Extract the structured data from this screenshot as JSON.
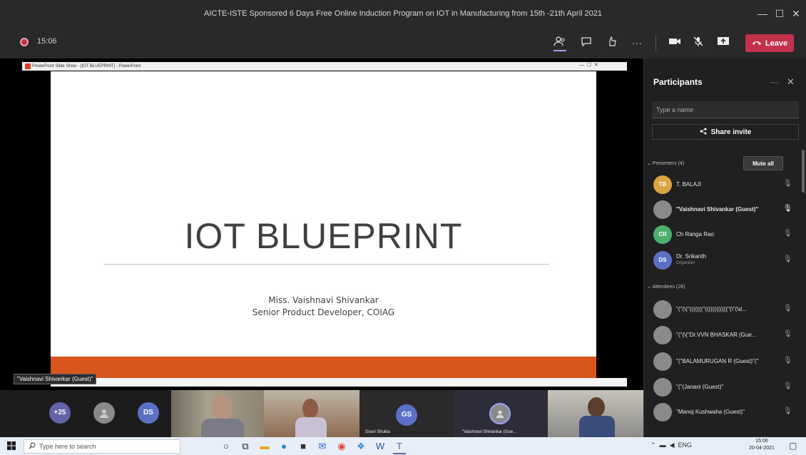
{
  "window": {
    "title": "AICTE-ISTE Sponsored 6 Days Free Online Induction Program on IOT in Manufacturing from 15th -21th April 2021",
    "minimize": "—",
    "maximize": "☐",
    "close": "✕"
  },
  "toolbar": {
    "timer": "15:06",
    "leave_label": "Leave",
    "icons": [
      "participants-icon",
      "chat-icon",
      "reactions-icon",
      "more-icon",
      "camera-icon",
      "mic-icon",
      "share-icon",
      "phone-icon"
    ]
  },
  "ppt": {
    "window_title": "PowerPoint Slide Show - [IOT BLUEPRINT] - PowerPoint",
    "slide_title": "IOT BLUEPRINT",
    "presenter_name": "Miss. Vaishnavi Shivankar",
    "presenter_role": "Senior Product Developer, COIAG"
  },
  "stage": {
    "presenter_tag": "\"Vaishnavi Shivankar (Guest)\""
  },
  "gallery": {
    "overflow_count": "+25",
    "initials_ds": "DS",
    "initials_gs": "GS",
    "gs_name": "Gouri Shukla",
    "vs_name": "\"Vaishnavi Shivankar (Gue..."
  },
  "panel": {
    "title": "Participants",
    "more": "···",
    "close": "✕",
    "search_placeholder": "Type a name",
    "share_invite": "Share invite",
    "presenters_header": "Presenters (4)",
    "mute_all": "Mute all",
    "attendees_header": "Attendees (28)",
    "presenters": [
      {
        "initials": "TB",
        "name": "T. BALAJI",
        "sub": "",
        "color": "#d9a441"
      },
      {
        "initials": "",
        "name": "\"Vaishnavi Shivankar (Guest)\"",
        "sub": "",
        "color": "#8a8a8a"
      },
      {
        "initials": "CR",
        "name": "Ch Ranga Rao",
        "sub": "",
        "color": "#4caf6d"
      },
      {
        "initials": "DS",
        "name": "Dr. Srikanth",
        "sub": "Organizer",
        "color": "#5b6fc7"
      }
    ],
    "attendees": [
      {
        "name": "\"(\"(\\(\"(((((((\"((((((((((((\"(\\\"(\\d...",
        "color": "#8a8a8a"
      },
      {
        "name": "\"(\"(\\(\"Dr.VVN BHASKAR (Gue...",
        "color": "#8a8a8a"
      },
      {
        "name": "\"(\"BALAMURUGAN R (Guest)\"(\"",
        "color": "#8a8a8a"
      },
      {
        "name": "\"(\"(Janani (Guest)\"",
        "color": "#8a8a8a"
      },
      {
        "name": "\"Manoj Kushwaha (Guest)\"",
        "color": "#8a8a8a"
      }
    ]
  },
  "taskbar": {
    "search_placeholder": "Type here to search",
    "time": "15:06",
    "date": "20-04-2021",
    "lang": "ENG"
  },
  "colors": {
    "leave": "#c4314b",
    "slide_band": "#d9551e",
    "overflow_badge": "#6264a7"
  }
}
